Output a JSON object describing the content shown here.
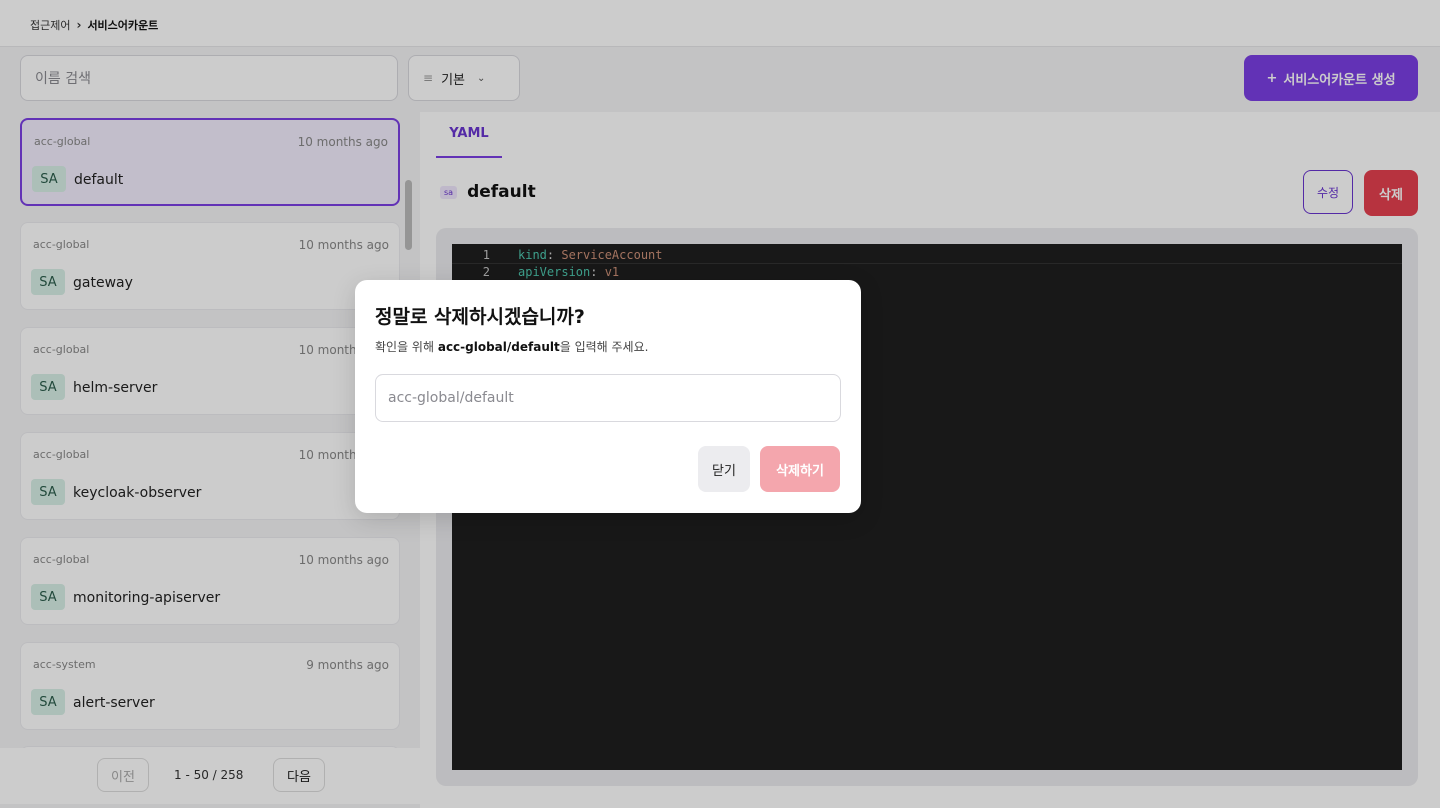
{
  "breadcrumb": {
    "parent": "접근제어",
    "separator": "›",
    "current": "서비스어카운트"
  },
  "search": {
    "placeholder": "이름 검색"
  },
  "filter": {
    "label": "기본"
  },
  "create_button": {
    "plus": "+",
    "label": "서비스어카운트 생성"
  },
  "list": {
    "items": [
      {
        "namespace": "acc-global",
        "age": "10 months ago",
        "badge": "SA",
        "name": "default",
        "selected": true
      },
      {
        "namespace": "acc-global",
        "age": "10 months ago",
        "badge": "SA",
        "name": "gateway"
      },
      {
        "namespace": "acc-global",
        "age": "10 months ago",
        "badge": "SA",
        "name": "helm-server"
      },
      {
        "namespace": "acc-global",
        "age": "10 months ago",
        "badge": "SA",
        "name": "keycloak-observer"
      },
      {
        "namespace": "acc-global",
        "age": "10 months ago",
        "badge": "SA",
        "name": "monitoring-apiserver"
      },
      {
        "namespace": "acc-system",
        "age": "9 months ago",
        "badge": "SA",
        "name": "alert-server"
      }
    ]
  },
  "pagination": {
    "prev": "이전",
    "info": "1 - 50 / 258",
    "next": "다음"
  },
  "detail": {
    "tab": "YAML",
    "tag": "sa",
    "title": "default",
    "edit": "수정",
    "delete": "삭제",
    "yaml_lines": [
      {
        "num": "1",
        "key": "kind",
        "value": "ServiceAccount"
      },
      {
        "num": "2",
        "key": "apiVersion",
        "value": "v1"
      }
    ]
  },
  "modal": {
    "title": "정말로 삭제하시겠습니까?",
    "desc_prefix": "확인을 위해 ",
    "desc_bold": "acc-global/default",
    "desc_suffix": "을 입력해 주세요.",
    "input_placeholder": "acc-global/default",
    "close": "닫기",
    "confirm": "삭제하기"
  },
  "colors": {
    "accent": "#7b3fe4",
    "danger": "#e5404f",
    "danger_disabled": "#f4a6ad"
  }
}
